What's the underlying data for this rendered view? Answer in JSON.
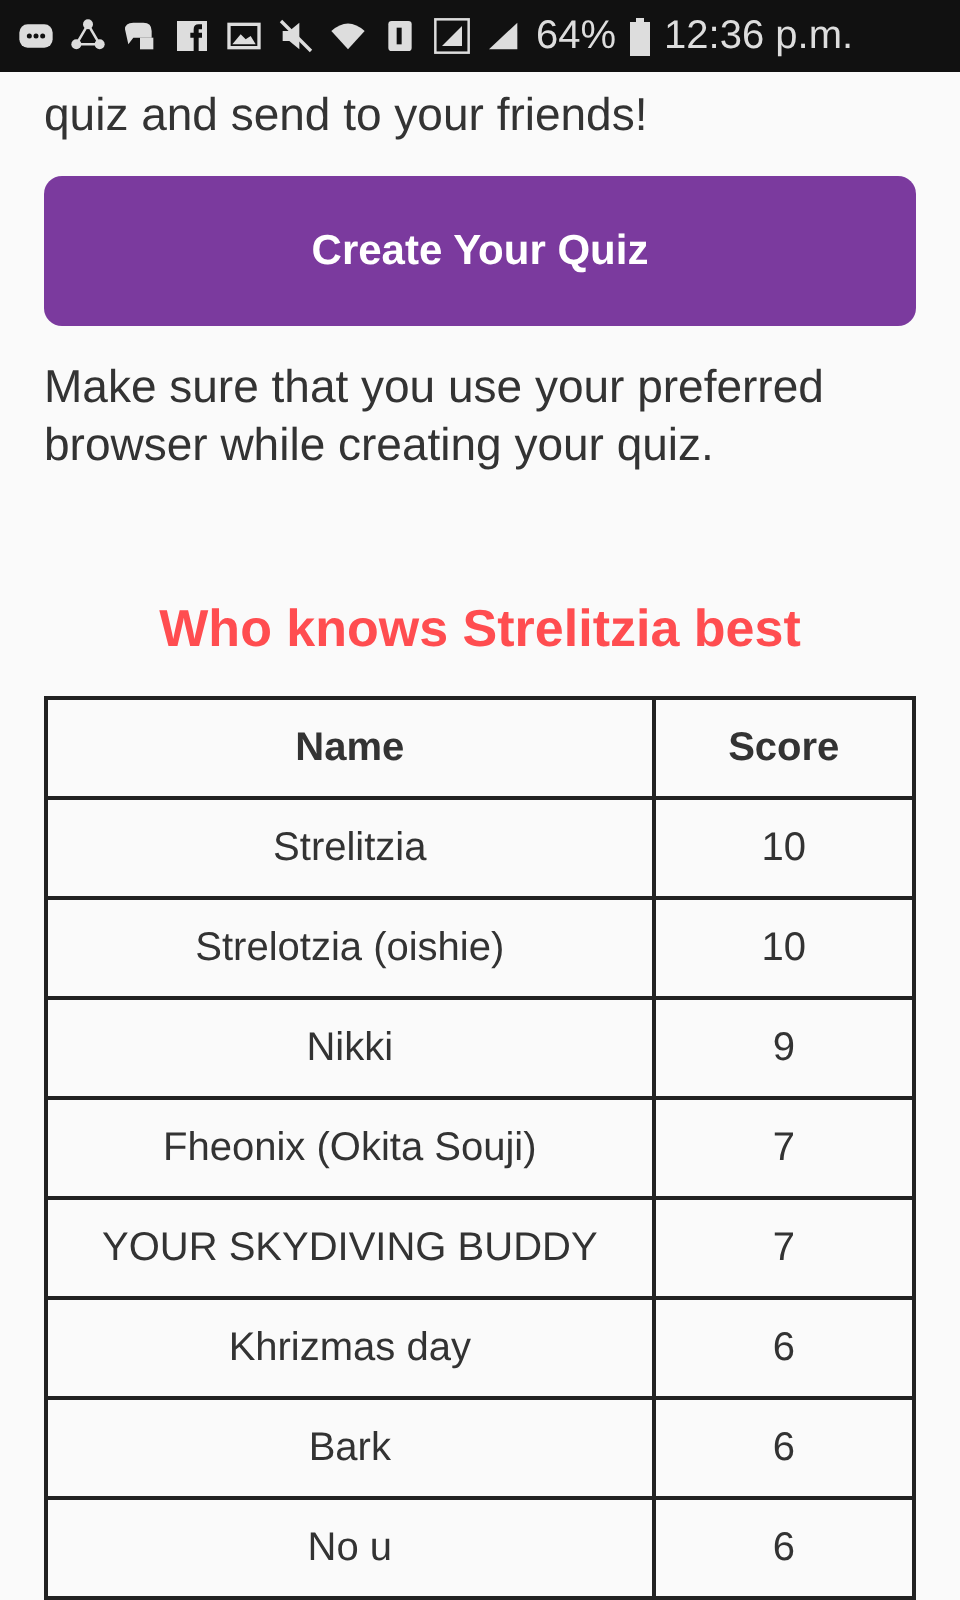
{
  "status_bar": {
    "battery": "64%",
    "time": "12:36 p.m."
  },
  "intro": "quiz and send to your friends!",
  "create_button": "Create Your Quiz",
  "note": "Make sure that you use your preferred browser while creating your quiz.",
  "leaderboard": {
    "title": "Who knows Strelitzia best",
    "columns": [
      "Name",
      "Score"
    ],
    "rows": [
      [
        "Strelitzia",
        "10"
      ],
      [
        "Strelotzia (oishie)",
        "10"
      ],
      [
        "Nikki",
        "9"
      ],
      [
        "Fheonix (Okita Souji)",
        "7"
      ],
      [
        "YOUR SKYDIVING BUDDY",
        "7"
      ],
      [
        "Khrizmas day",
        "6"
      ],
      [
        "Bark",
        "6"
      ],
      [
        "No u",
        "6"
      ]
    ]
  }
}
